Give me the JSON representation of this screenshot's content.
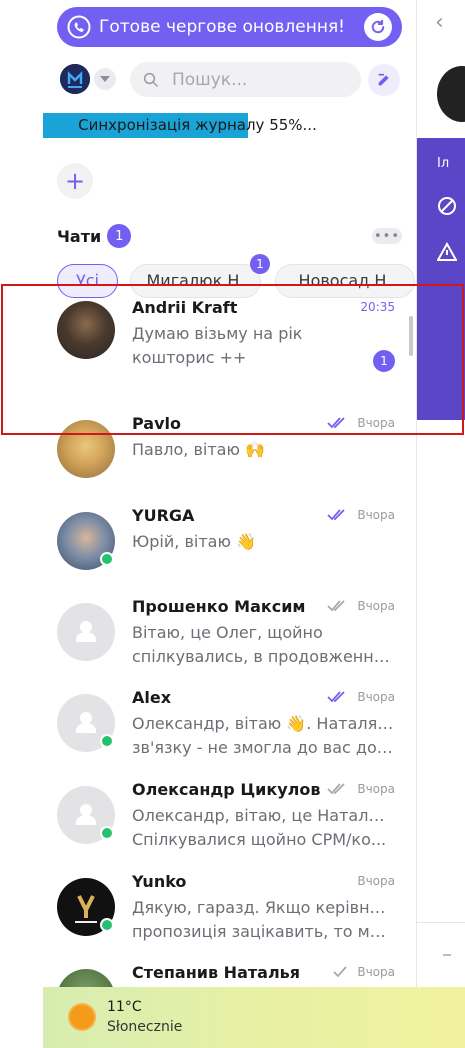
{
  "update_banner": {
    "text": "Готове чергове оновлення!"
  },
  "search": {
    "placeholder": "Пошук..."
  },
  "sync": {
    "text": "Синхронізація журналу 55%...",
    "progress": 0.55
  },
  "chats": {
    "title": "Чати",
    "badge": "1"
  },
  "tabs": [
    {
      "label": "Усі",
      "active": true
    },
    {
      "label": "Мигалюк Н.",
      "badge": "1"
    },
    {
      "label": "Новосад Н."
    }
  ],
  "chat_items": [
    {
      "name": "Andrii Kraft",
      "time": "20:35",
      "unread": "1",
      "preview": [
        "Думаю візьму на рік",
        "кошторис ++"
      ]
    },
    {
      "name": "Pavlo",
      "time": "Вчора",
      "status": "read",
      "preview": [
        "Павло, вітаю 🙌"
      ]
    },
    {
      "name": "YURGA",
      "time": "Вчора",
      "status": "read",
      "preview": [
        "Юрій, вітаю 👋"
      ]
    },
    {
      "name": "Прошенко Максим",
      "time": "Вчора",
      "status": "delivered",
      "preview": [
        "Вітаю, це Олег, щойно",
        "спілкувались, в продовження ..."
      ]
    },
    {
      "name": "Alex",
      "time": "Вчора",
      "status": "read",
      "preview": [
        "Олександр, вітаю 👋. Наталя на",
        "зв'язку - не змогла до вас доз..."
      ]
    },
    {
      "name": "Олександр Цикулов",
      "time": "Вчора",
      "status": "delivered",
      "preview": [
        "Олександр, вітаю, це Наталя 🙌",
        "Спілкувалися щойно CPM/ко..."
      ]
    },
    {
      "name": "Yunko",
      "time": "Вчора",
      "preview": [
        "Дякую, гаразд. Якщо керівника",
        "пропозиція зацікавить, то ми і..."
      ]
    },
    {
      "name": "Степанив Наталья",
      "time": "Вчора",
      "status": "sent",
      "preview": []
    }
  ],
  "weather": {
    "temp": "11°C",
    "condition": "Słonecznie"
  },
  "right_pane": {
    "label": "Іл"
  },
  "colors": {
    "accent": "#7360f2",
    "online": "#25c16f",
    "sync": "#1aa3d6",
    "highlight": "#d01818"
  }
}
